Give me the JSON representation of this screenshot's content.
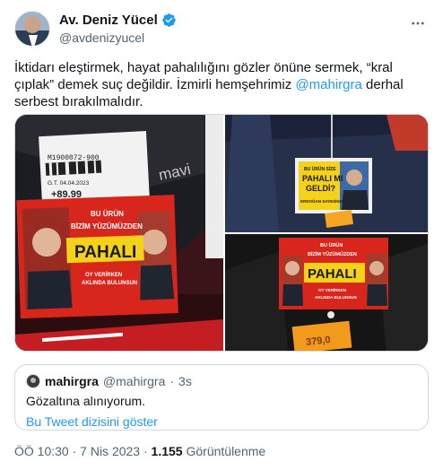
{
  "author": {
    "display_name": "Av. Deniz Yücel",
    "handle": "@avdenizyucel",
    "verified": true
  },
  "tweet": {
    "text_before": "İktidarı eleştirmek, hayat pahalılığını gözler önüne sermek, “kral çıplak” demek suç değildir. İzmirli hemşehrimiz ",
    "mention": "@mahirgra",
    "text_after": " derhal serbest bırakılmalıdır."
  },
  "media": {
    "photo1": {
      "tag_code": "M1900072-900",
      "tag_date": "G.T. 04.04.2023",
      "tag_price": "+89.99",
      "brand": "mavi",
      "sticker_top_line1": "BU ÜRÜN",
      "sticker_top_line2": "BİZİM YÜZÜMÜZDEN",
      "sticker_main": "PAHALI",
      "sticker_bottom_line1": "OY VERİRKEN",
      "sticker_bottom_line2": "AKLINDA BULUNSUN"
    },
    "photo2": {
      "line1": "BU ÜRÜN SİZE",
      "line2": "PAHALI MI",
      "line3": "GELDİ?",
      "line4": "ERDOĞAN SAYESİNDE"
    },
    "photo3": {
      "sticker_top_line1": "BU ÜRÜN",
      "sticker_top_line2": "BİZİM YÜZÜMÜZDEN",
      "sticker_main": "PAHALI",
      "sticker_bottom_line1": "OY VERİRKEN",
      "sticker_bottom_line2": "AKLINDA BULUNSUN",
      "price": "379,0"
    }
  },
  "quote": {
    "name": "mahirgra",
    "handle": "@mahirgra",
    "dot": "·",
    "time": "3s",
    "text": "Gözaltına alınıyorum.",
    "link": "Bu Tweet dizisini göster"
  },
  "meta": {
    "time": "ÖÖ 10:30",
    "date": "7 Nis 2023",
    "views_count": "1.155",
    "views_label": "Görüntülenme",
    "sep": "·"
  },
  "colors": {
    "accent": "#1d9bf0",
    "text": "#0f1419",
    "secondary": "#536471",
    "border": "#cfd9de",
    "sticker_red": "#d9261c",
    "sticker_yellow": "#f4d21a"
  },
  "icons": [
    "verified-badge-icon",
    "more-options-icon"
  ]
}
